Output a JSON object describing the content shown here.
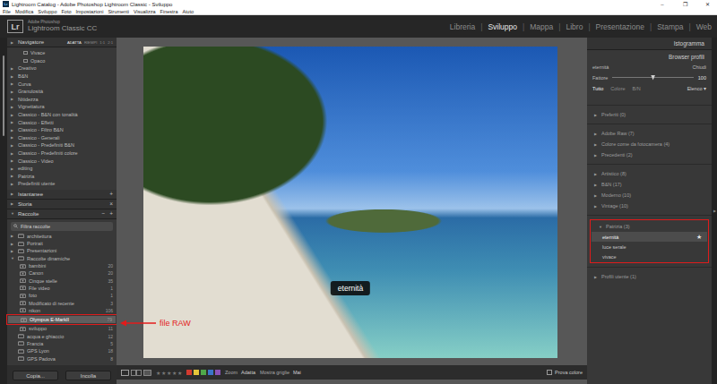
{
  "window": {
    "title": "Lightroom Catalog - Adobe Photoshop Lightroom Classic - Sviluppo",
    "controls": [
      "–",
      "❐",
      "✕"
    ]
  },
  "menu": [
    "File",
    "Modifica",
    "Sviluppo",
    "Foto",
    "Impostazioni",
    "Strumenti",
    "Visualizza",
    "Finestra",
    "Aiuto"
  ],
  "header": {
    "logo": "Lr",
    "brand_small": "Adobe Photoshop",
    "brand": "Lightroom Classic CC",
    "separator": "|",
    "modules": [
      {
        "label": "Libreria",
        "selected": false
      },
      {
        "label": "Sviluppo",
        "selected": true
      },
      {
        "label": "Mappa",
        "selected": false
      },
      {
        "label": "Libro",
        "selected": false
      },
      {
        "label": "Presentazione",
        "selected": false
      },
      {
        "label": "Stampa",
        "selected": false
      },
      {
        "label": "Web",
        "selected": false
      }
    ]
  },
  "markers": {
    "collapsed": "▶",
    "expanded": "▼"
  },
  "left_panel": {
    "navigator": {
      "title": "Navigatore",
      "expanded": false,
      "zoom_options": [
        {
          "label": "ADATTA",
          "selected": true
        },
        {
          "label": "RIEMPI",
          "selected": false
        },
        {
          "label": "1:1",
          "selected": false
        },
        {
          "label": "2:1",
          "selected": false
        }
      ]
    },
    "presets": [
      {
        "label": "Vivace",
        "kind": "preset"
      },
      {
        "label": "Opaco",
        "kind": "preset"
      },
      {
        "label": "Creativo",
        "kind": "folder",
        "expanded": false
      },
      {
        "label": "B&N",
        "kind": "folder",
        "expanded": false
      },
      {
        "label": "Curva",
        "kind": "folder",
        "expanded": false
      },
      {
        "label": "Granulosità",
        "kind": "folder",
        "expanded": false
      },
      {
        "label": "Nitidezza",
        "kind": "folder",
        "expanded": false
      },
      {
        "label": "Vignettatura",
        "kind": "folder",
        "expanded": false
      },
      {
        "label": "Classico - B&N con tonalità",
        "kind": "folder",
        "expanded": false
      },
      {
        "label": "Classico - Effetti",
        "kind": "folder",
        "expanded": false
      },
      {
        "label": "Classico - Filtro B&N",
        "kind": "folder",
        "expanded": false
      },
      {
        "label": "Classico - Generali",
        "kind": "folder",
        "expanded": false
      },
      {
        "label": "Classico - Predefiniti B&N",
        "kind": "folder",
        "expanded": false
      },
      {
        "label": "Classico - Predefiniti colore",
        "kind": "folder",
        "expanded": false
      },
      {
        "label": "Classico - Video",
        "kind": "folder",
        "expanded": false
      },
      {
        "label": "editing",
        "kind": "folder",
        "expanded": false
      },
      {
        "label": "Patrizia",
        "kind": "folder",
        "expanded": false
      },
      {
        "label": "Predefiniti utente",
        "kind": "folder",
        "expanded": false
      }
    ],
    "sections": [
      {
        "title": "Istantanee",
        "expanded": false,
        "actions": [
          "+"
        ]
      },
      {
        "title": "Storia",
        "expanded": false,
        "actions": [
          "×"
        ]
      }
    ],
    "collections": {
      "title": "Raccolte",
      "expanded": true,
      "actions": [
        "−",
        "+"
      ],
      "filter": "Filtra raccolte",
      "items": [
        {
          "label": "architettura",
          "kind": "set",
          "expanded": false,
          "count": "",
          "selected": false,
          "annotated": false
        },
        {
          "label": "Portrait",
          "kind": "set",
          "expanded": false,
          "count": "",
          "selected": false,
          "annotated": false
        },
        {
          "label": "Presentazioni",
          "kind": "set",
          "expanded": false,
          "count": "",
          "selected": false,
          "annotated": false
        },
        {
          "label": "Raccolte dinamiche",
          "kind": "set",
          "expanded": true,
          "count": "",
          "selected": false,
          "annotated": false
        },
        {
          "label": "bambini",
          "kind": "smart",
          "expanded": false,
          "count": "20",
          "selected": false,
          "annotated": false
        },
        {
          "label": "Canon",
          "kind": "smart",
          "expanded": false,
          "count": "20",
          "selected": false,
          "annotated": false
        },
        {
          "label": "Cinque stelle",
          "kind": "smart",
          "expanded": false,
          "count": "35",
          "selected": false,
          "annotated": false
        },
        {
          "label": "File video",
          "kind": "smart",
          "expanded": false,
          "count": "1",
          "selected": false,
          "annotated": false
        },
        {
          "label": "foto",
          "kind": "smart",
          "expanded": false,
          "count": "1",
          "selected": false,
          "annotated": false
        },
        {
          "label": "Modificato di recente",
          "kind": "smart",
          "expanded": false,
          "count": "3",
          "selected": false,
          "annotated": false
        },
        {
          "label": "nikon",
          "kind": "smart",
          "expanded": false,
          "count": "106",
          "selected": false,
          "annotated": false
        },
        {
          "label": "Olympus E-MarkII",
          "kind": "smart",
          "expanded": false,
          "count": "79",
          "selected": true,
          "annotated": true
        },
        {
          "label": "sviluppo",
          "kind": "smart",
          "expanded": false,
          "count": "11",
          "selected": false,
          "annotated": false
        },
        {
          "label": "acqua e ghiaccio",
          "kind": "collection",
          "expanded": false,
          "count": "12",
          "selected": false,
          "annotated": false
        },
        {
          "label": "Francia",
          "kind": "collection",
          "expanded": false,
          "count": "5",
          "selected": false,
          "annotated": false
        },
        {
          "label": "GPS Lyon",
          "kind": "collection",
          "expanded": false,
          "count": "18",
          "selected": false,
          "annotated": false
        },
        {
          "label": "GPS Padova",
          "kind": "collection",
          "expanded": false,
          "count": "8",
          "selected": false,
          "annotated": false
        }
      ]
    },
    "buttons": [
      "Copia...",
      "Incolla"
    ]
  },
  "annotation": {
    "text": "file RAW"
  },
  "photo": {
    "overlay": "eternità"
  },
  "toolbar": {
    "star_glyph": "★",
    "stars": 0,
    "star_count": 5,
    "color_labels": [
      "#d23a2f",
      "#e5c53a",
      "#4fa84a",
      "#3b74c9",
      "#8a52b8"
    ],
    "zoom_label": "Zoom",
    "zoom_value": "Adatta",
    "grid_label": "Mostra griglie",
    "grid_value": "Mai",
    "soft_proof": {
      "label": "Prova colore",
      "checked": false
    }
  },
  "right_panel": {
    "histogram": "Istogramma",
    "browser_title": "Browser profili",
    "current": "eternità",
    "close": "Chiudi",
    "amount": {
      "label": "Fattore",
      "level": 0.5,
      "reading": "100"
    },
    "filters": [
      {
        "label": "Tutto",
        "selected": true
      },
      {
        "label": "Colore",
        "selected": false
      },
      {
        "label": "B/N",
        "selected": false
      }
    ],
    "view": "Elenco",
    "view_arrow": "▾",
    "favorite_glyph": "★",
    "side_arrow": "▶",
    "sections": [
      {
        "groups": [
          {
            "label": "Preferiti (0)",
            "expanded": false,
            "annotated": false,
            "profiles": []
          }
        ]
      },
      {
        "groups": [
          {
            "label": "Adobe Raw (7)",
            "expanded": false,
            "annotated": false,
            "profiles": []
          },
          {
            "label": "Colore come da fotocamera (4)",
            "expanded": false,
            "annotated": false,
            "profiles": []
          },
          {
            "label": "Precedenti (2)",
            "expanded": false,
            "annotated": false,
            "profiles": []
          }
        ]
      },
      {
        "groups": [
          {
            "label": "Artistico (8)",
            "expanded": false,
            "annotated": false,
            "profiles": []
          },
          {
            "label": "B&N (17)",
            "expanded": false,
            "annotated": false,
            "profiles": []
          },
          {
            "label": "Moderno (10)",
            "expanded": false,
            "annotated": false,
            "profiles": []
          },
          {
            "label": "Vintage (10)",
            "expanded": false,
            "annotated": false,
            "profiles": []
          }
        ]
      },
      {
        "groups": [
          {
            "label": "Patrizia (3)",
            "expanded": true,
            "annotated": true,
            "profiles": [
              {
                "label": "eternità",
                "selected": true,
                "favorite": true
              },
              {
                "label": "luce serale",
                "selected": false,
                "favorite": false
              },
              {
                "label": "vivace",
                "selected": false,
                "favorite": false
              }
            ]
          }
        ]
      },
      {
        "groups": [
          {
            "label": "Profili utente (1)",
            "expanded": false,
            "annotated": false,
            "profiles": []
          }
        ]
      }
    ]
  }
}
